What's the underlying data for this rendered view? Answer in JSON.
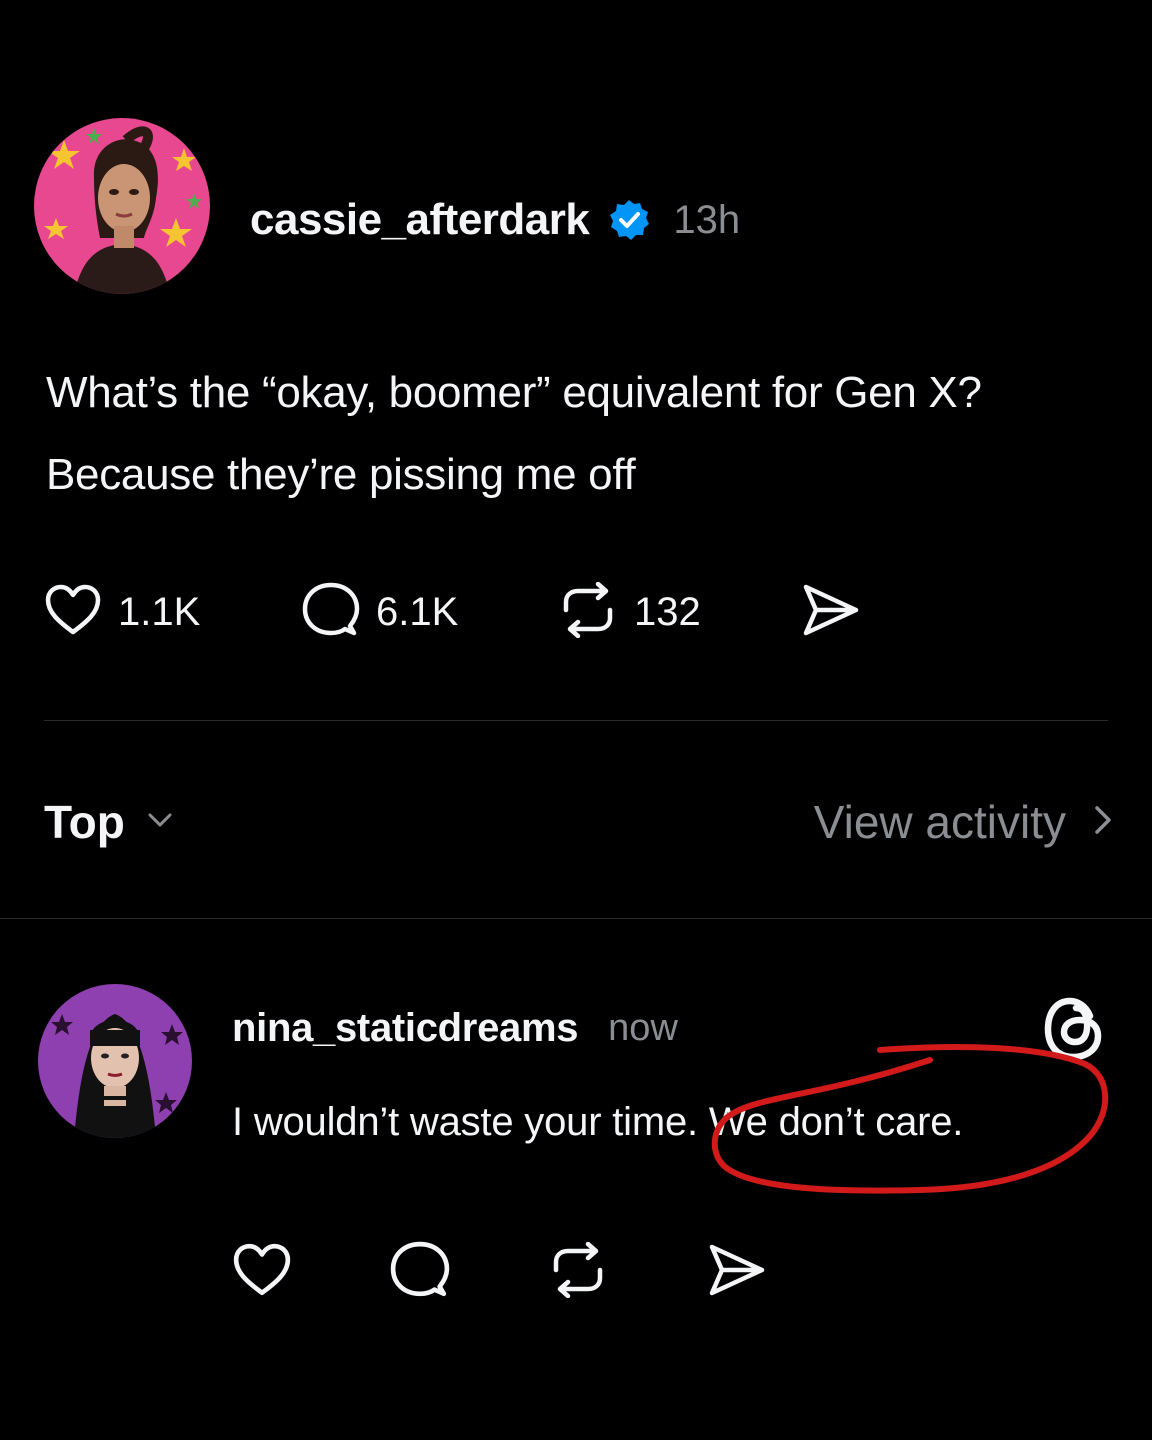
{
  "post": {
    "author": {
      "username": "cassie_afterdark",
      "verified": true,
      "timestamp": "13h"
    },
    "text_line_1": "What’s the “okay, boomer” equivalent for Gen X?",
    "text_line_2": "Because they’re pissing me off",
    "stats": {
      "likes": "1.1K",
      "replies": "6.1K",
      "reposts": "132"
    }
  },
  "sort": {
    "label": "Top",
    "view_activity_label": "View activity"
  },
  "reply": {
    "author": {
      "username": "nina_staticdreams",
      "timestamp": "now"
    },
    "text_before": "I wouldn’t waste your time",
    "text_circled": ". We don’t care.",
    "annotation_color": "#d21a1a"
  },
  "colors": {
    "background": "#000000",
    "text_primary": "#f3f5f7",
    "text_secondary": "#8a8d91",
    "verified_badge": "#0095f6",
    "divider": "#2b2b2b"
  },
  "icons": {
    "like": "heart-icon",
    "reply": "speech-bubble-icon",
    "repost": "repost-arrows-icon",
    "share": "send-icon",
    "sort": "chevron-down-icon",
    "view_activity": "chevron-right-icon",
    "app": "threads-logo"
  }
}
